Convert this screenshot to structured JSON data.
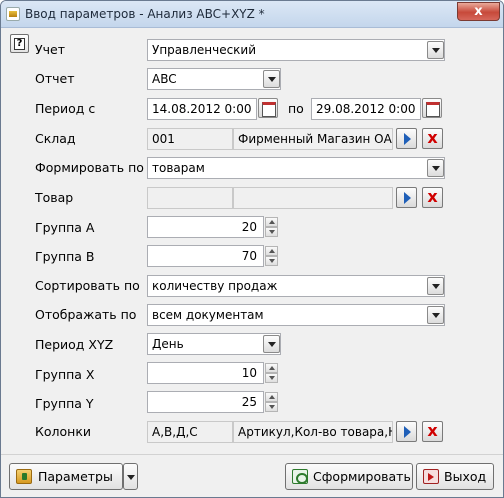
{
  "window": {
    "title": "Ввод параметров - Анализ ABC+XYZ *",
    "close_glyph": "x"
  },
  "help": {
    "glyph": "?"
  },
  "fields": {
    "uchet": {
      "label": "Учет",
      "value": "Управленческий"
    },
    "otchet": {
      "label": "Отчет",
      "value": "ABC"
    },
    "period": {
      "label": "Период с",
      "from": "14.08.2012 0:00",
      "to_label": "по",
      "to": "29.08.2012 0:00"
    },
    "sklad": {
      "label": "Склад",
      "code": "001",
      "name": "Фирменный Магазин ОАО"
    },
    "formirovat": {
      "label": "Формировать по",
      "value": "товарам"
    },
    "tovar": {
      "label": "Товар",
      "code": "",
      "name": ""
    },
    "group_a": {
      "label": "Группа А",
      "value": "20"
    },
    "group_b": {
      "label": "Группа В",
      "value": "70"
    },
    "sortirovat": {
      "label": "Сортировать по",
      "value": "количеству продаж"
    },
    "otobrazhat": {
      "label": "Отображать по",
      "value": "всем документам"
    },
    "period_xyz": {
      "label": "Период XYZ",
      "value": "День"
    },
    "group_x": {
      "label": "Группа X",
      "value": "10"
    },
    "group_y": {
      "label": "Группа Y",
      "value": "25"
    },
    "kolonki": {
      "label": "Колонки",
      "code": "A,B,Д,С",
      "name": "Артикул,Кол-во товара,Н"
    }
  },
  "footer": {
    "params_label": "Параметры",
    "generate_label": "Сформировать",
    "exit_label": "Выход"
  },
  "colors": {
    "clear_red": "#d00000",
    "go_blue": "#1f5fb8"
  },
  "icons": {
    "clear": "x"
  }
}
